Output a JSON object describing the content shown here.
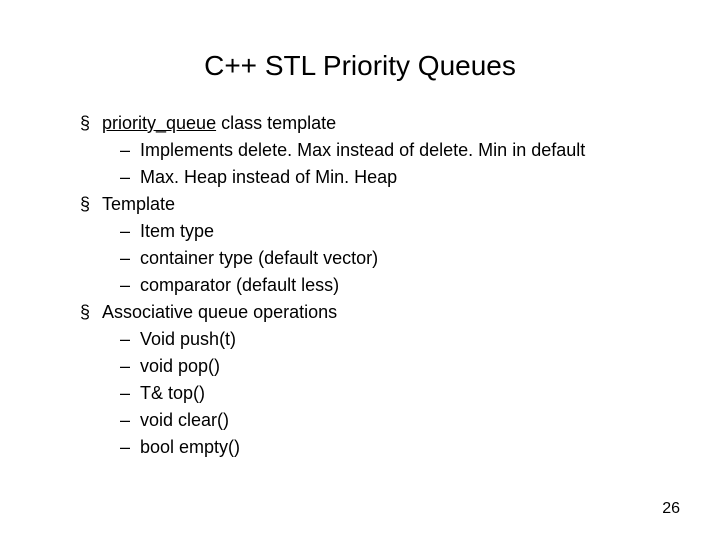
{
  "title": "C++ STL Priority Queues",
  "bullets": [
    {
      "prefix": "priority_queue",
      "suffix": " class template",
      "sub": [
        "Implements delete. Max instead of delete. Min in default",
        "Max. Heap instead of Min. Heap"
      ]
    },
    {
      "prefix": "",
      "suffix": "Template",
      "sub": [
        "Item type",
        "container type (default vector)",
        "comparator (default less)"
      ]
    },
    {
      "prefix": "",
      "suffix": "Associative queue operations",
      "sub": [
        "Void push(t)",
        "void pop()",
        "T& top()",
        "void clear()",
        "bool empty()"
      ]
    }
  ],
  "page_number": "26"
}
